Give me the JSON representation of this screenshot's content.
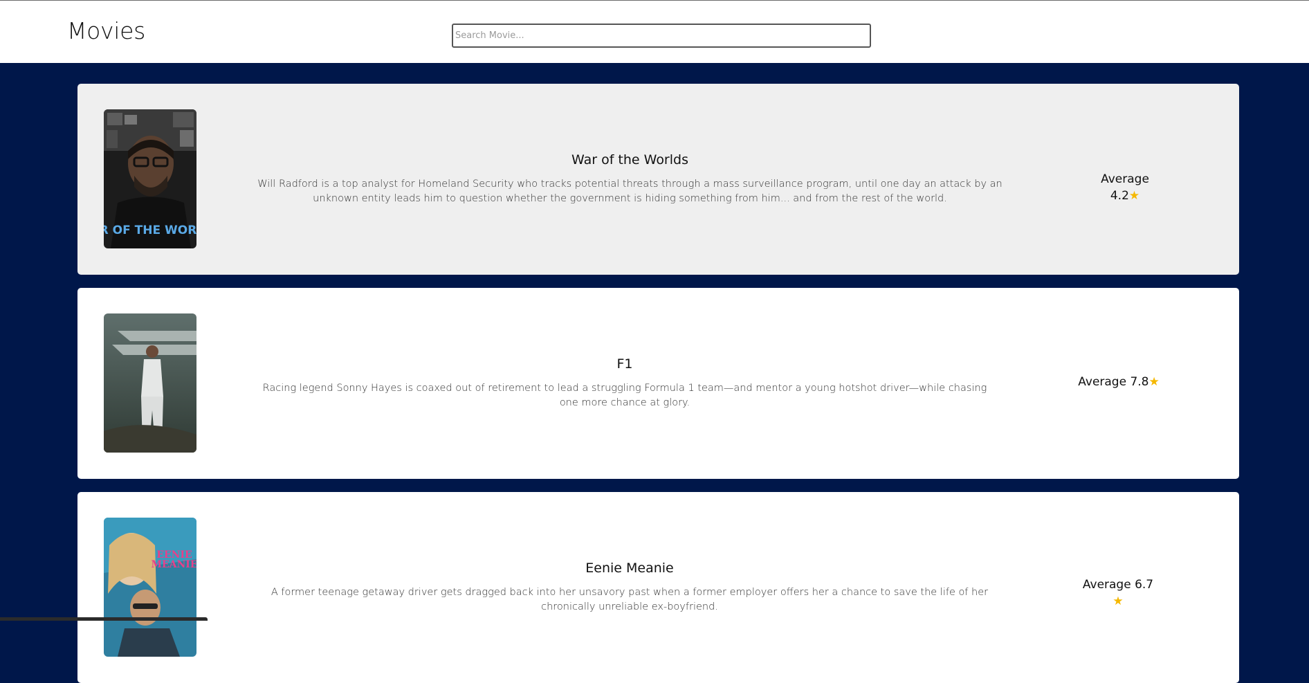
{
  "header": {
    "title": "Movies",
    "search_placeholder": "Search Movie...",
    "search_value": ""
  },
  "movies": [
    {
      "title": "War of the Worlds",
      "poster_icon": "war-of-the-worlds-poster",
      "description": "Will Radford is a top analyst for Homeland Security who tracks potential threats through a mass surveillance program, until one day an attack by an unknown entity leads him to question whether the government is hiding something from him... and from the rest of the world.",
      "rating_label": "Average",
      "rating_value": "4.2",
      "star": "★"
    },
    {
      "title": "F1",
      "poster_icon": "f1-poster",
      "description": "Racing legend Sonny Hayes is coaxed out of retirement to lead a struggling Formula 1 team—and mentor a young hotshot driver—while chasing one more chance at glory.",
      "rating_label": "Average 7.8",
      "rating_value": "",
      "star": "★"
    },
    {
      "title": "Eenie Meanie",
      "poster_icon": "eenie-meanie-poster",
      "description": "A former teenage getaway driver gets dragged back into her unsavory past when a former employer offers her a chance to save the life of her chronically unreliable ex-boyfriend.",
      "rating_label": "Average 6.7",
      "rating_value": "",
      "star": "★"
    }
  ],
  "colors": {
    "page_background": "#00174a",
    "card_highlight": "#efefef",
    "card": "#ffffff",
    "star": "#f5b800"
  }
}
